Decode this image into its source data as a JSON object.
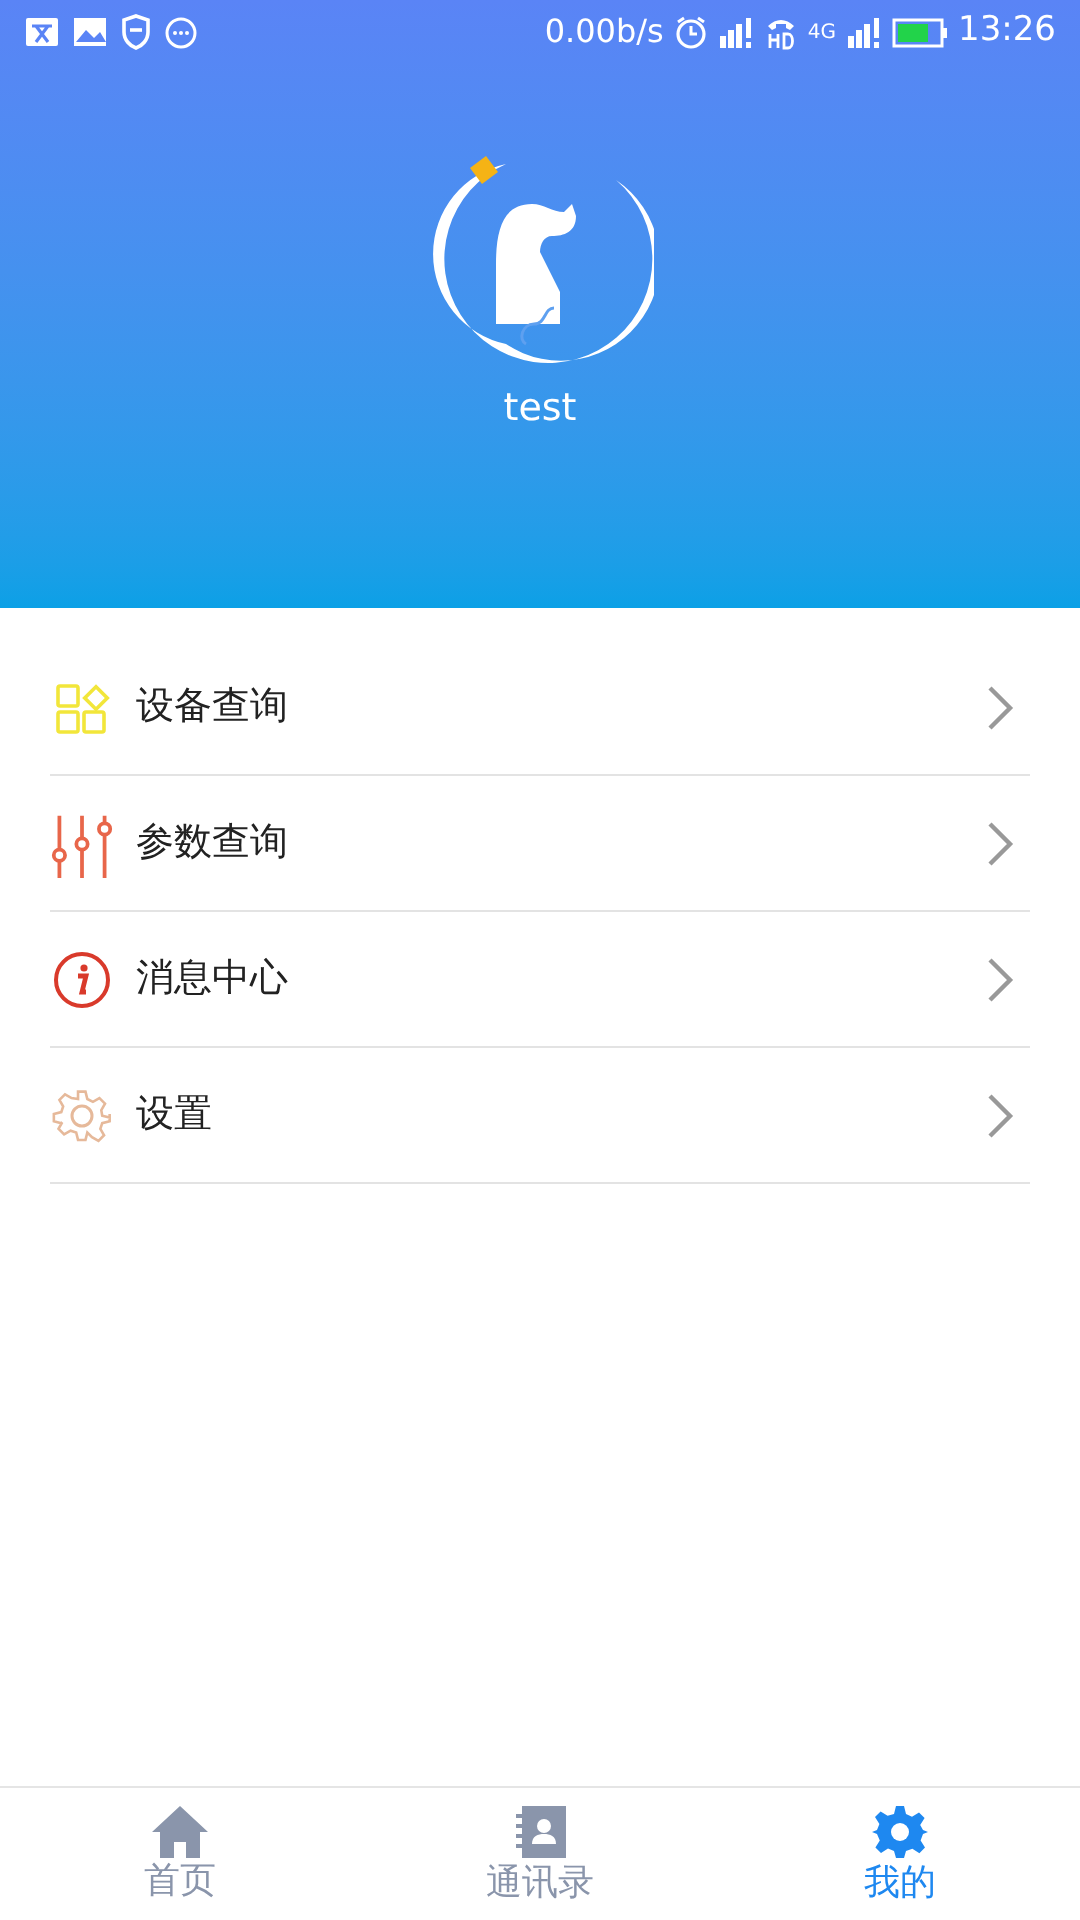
{
  "status_bar": {
    "speed": "0.00b/s",
    "network": "4G",
    "time": "13:26"
  },
  "profile": {
    "username": "test"
  },
  "menu": [
    {
      "kind": "devices",
      "label": "设备查询"
    },
    {
      "kind": "params",
      "label": "参数查询"
    },
    {
      "kind": "info",
      "label": "消息中心"
    },
    {
      "kind": "settings",
      "label": "设置"
    }
  ],
  "tabs": [
    {
      "kind": "home",
      "label": "首页",
      "selected": false
    },
    {
      "kind": "contacts",
      "label": "通讯录",
      "selected": false
    },
    {
      "kind": "mine",
      "label": "我的",
      "selected": true
    }
  ]
}
